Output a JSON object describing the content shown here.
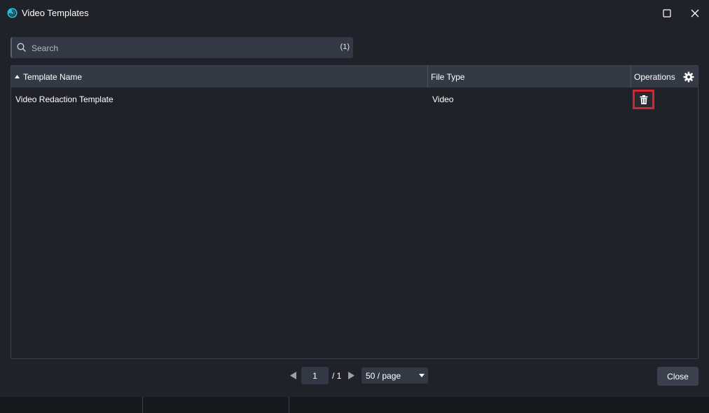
{
  "window": {
    "title": "Video Templates",
    "icons": {
      "app": "swirl-logo-icon",
      "maximize": "maximize-icon",
      "close": "close-icon"
    }
  },
  "search": {
    "placeholder": "Search",
    "value": "",
    "count": "(1)"
  },
  "table": {
    "columns": {
      "name": "Template Name",
      "type": "File Type",
      "operations": "Operations"
    },
    "sort": {
      "column": "name",
      "direction": "ascending"
    },
    "rows": [
      {
        "name": "Video Redaction Template",
        "type": "Video",
        "action_icon": "trash-icon"
      }
    ]
  },
  "pagination": {
    "current_page": "1",
    "total": "/ 1",
    "page_size": "50 / page"
  },
  "footer": {
    "close_label": "Close"
  },
  "colors": {
    "background": "#1f2329",
    "header": "#333a45",
    "accent": "#19c3dc",
    "highlight": "#e0202a"
  }
}
